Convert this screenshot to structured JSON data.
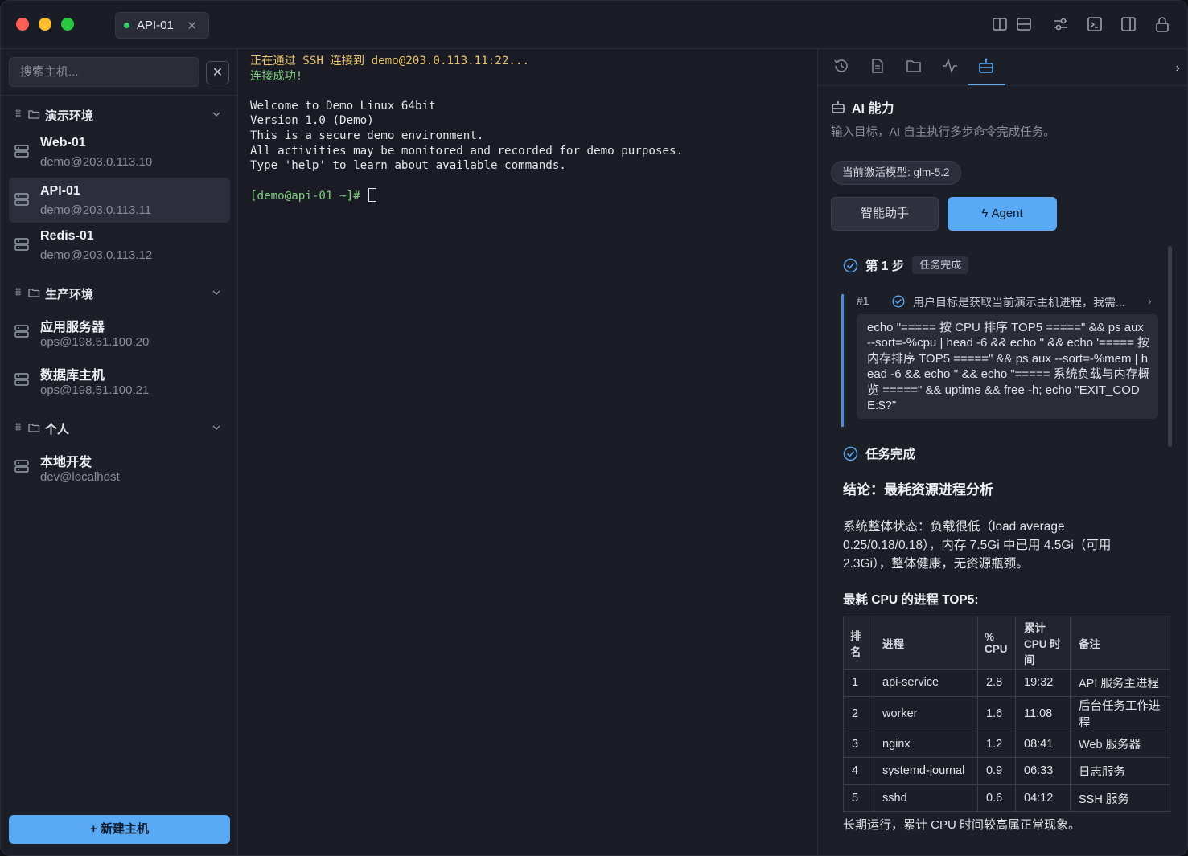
{
  "titlebar": {
    "tab_label": "API-01",
    "tab_close": "✕"
  },
  "sidebar": {
    "search_placeholder": "搜索主机...",
    "search_clear": "✕",
    "groups": [
      {
        "name": "演示环境",
        "hosts": [
          {
            "name": "Web-01",
            "addr": "demo@203.0.113.10"
          },
          {
            "name": "API-01",
            "addr": "demo@203.0.113.11"
          },
          {
            "name": "Redis-01",
            "addr": "demo@203.0.113.12"
          }
        ]
      },
      {
        "name": "生产环境",
        "hosts": [
          {
            "name": "应用服务器",
            "addr": "ops@198.51.100.20"
          },
          {
            "name": "数据库主机",
            "addr": "ops@198.51.100.21"
          }
        ]
      },
      {
        "name": "个人",
        "hosts": [
          {
            "name": "本地开发",
            "addr": "dev@localhost"
          }
        ]
      }
    ],
    "new_host_label": "+ 新建主机"
  },
  "terminal": {
    "line1": "正在通过 SSH 连接到 demo@203.0.113.11:22...",
    "line2": "连接成功!",
    "welcome": "Welcome to Demo Linux 64bit",
    "version": "Version 1.0 (Demo)",
    "secure": "This is a secure demo environment.",
    "monitor": "All activities may be monitored and recorded for demo purposes.",
    "help": "Type 'help' to learn about available commands.",
    "prompt": "[demo@api-01 ~]# "
  },
  "panel": {
    "title": "AI 能力",
    "subtitle": "输入目标，AI 自主执行多步命令完成任务。",
    "model_label": "当前激活模型: glm-5.2",
    "assist_btn": "智能助手",
    "agent_btn": "Agent",
    "step_title": "第 1 步",
    "step_badge": "任务完成",
    "step_num": "#1",
    "step_text": "用户目标是获取当前演示主机进程，我需...",
    "command": "echo \"===== 按 CPU 排序 TOP5 =====\" && ps aux --sort=-%cpu | head -6 && echo '' && echo '===== 按内存排序 TOP5 =====\" && ps aux --sort=-%mem | head -6 && echo '' && echo \"===== 系统负载与内存概览 =====\" && uptime && free -h; echo \"EXIT_CODE:$?\"",
    "done_label": "任务完成",
    "conclusion": "结论：最耗资源进程分析",
    "paragraph": "系统整体状态：负载很低（load average 0.25/0.18/0.18），内存 7.5Gi 中已用 4.5Gi（可用 2.3Gi），整体健康，无资源瓶颈。",
    "table_heading": "最耗 CPU 的进程 TOP5:",
    "table_headers": [
      "排名",
      "进程",
      "% CPU",
      "累计 CPU 时间",
      "备注"
    ],
    "table_rows": [
      [
        "1",
        "api-service",
        "2.8",
        "19:32",
        "API 服务主进程"
      ],
      [
        "2",
        "worker",
        "1.6",
        "11:08",
        "后台任务工作进程"
      ],
      [
        "3",
        "nginx",
        "1.2",
        "08:41",
        "Web 服务器"
      ],
      [
        "4",
        "systemd-journal",
        "0.9",
        "06:33",
        "日志服务"
      ],
      [
        "5",
        "sshd",
        "0.6",
        "04:12",
        "SSH 服务"
      ]
    ],
    "footer": "长期运行，累计 CPU 时间较高属正常现象。"
  },
  "colors": {
    "accent": "#5aa9f5",
    "prompt_green": "#7ed07e",
    "ssh_yellow": "#e9c46a"
  }
}
